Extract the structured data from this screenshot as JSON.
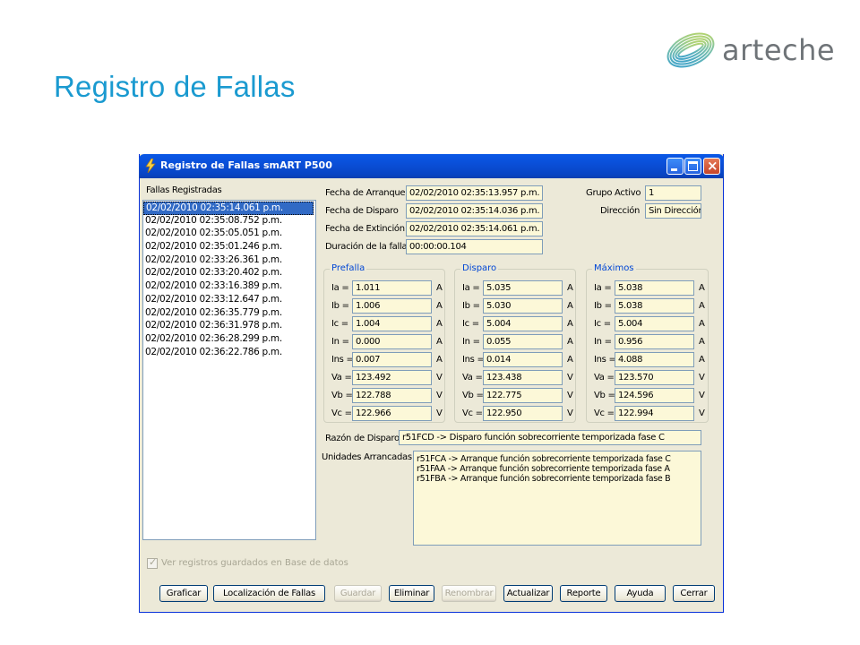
{
  "slide": {
    "title": "Registro de Fallas",
    "logo_text": "arteche"
  },
  "window": {
    "title": "Registro de Fallas smART P500",
    "fallas_label": "Fallas Registradas",
    "fallas": [
      "02/02/2010 02:35:14.061 p.m.",
      "02/02/2010 02:35:08.752 p.m.",
      "02/02/2010 02:35:05.051 p.m.",
      "02/02/2010 02:35:01.246 p.m.",
      "02/02/2010 02:33:26.361 p.m.",
      "02/02/2010 02:33:20.402 p.m.",
      "02/02/2010 02:33:16.389 p.m.",
      "02/02/2010 02:33:12.647 p.m.",
      "02/02/2010 02:36:35.779 p.m.",
      "02/02/2010 02:36:31.978 p.m.",
      "02/02/2010 02:36:28.299 p.m.",
      "02/02/2010 02:36:22.786 p.m."
    ],
    "info": {
      "arranque_label": "Fecha de Arranque",
      "arranque": "02/02/2010 02:35:13.957 p.m.",
      "disparo_label": "Fecha de Disparo",
      "disparo": "02/02/2010 02:35:14.036 p.m.",
      "extincion_label": "Fecha de Extinción",
      "extincion": "02/02/2010 02:35:14.061 p.m.",
      "duracion_label": "Duración de la falla",
      "duracion": "00:00:00.104",
      "grupo_label": "Grupo Activo",
      "grupo": "1",
      "direccion_label": "Dirección",
      "direccion": "Sin Dirección"
    },
    "groups": {
      "prefalla": {
        "title": "Prefalla",
        "rows": [
          {
            "label": "Ia =",
            "value": "1.011",
            "unit": "A"
          },
          {
            "label": "Ib =",
            "value": "1.006",
            "unit": "A"
          },
          {
            "label": "Ic =",
            "value": "1.004",
            "unit": "A"
          },
          {
            "label": "In =",
            "value": "0.000",
            "unit": "A"
          },
          {
            "label": "Ins =",
            "value": "0.007",
            "unit": "A"
          },
          {
            "label": "Va =",
            "value": "123.492",
            "unit": "V"
          },
          {
            "label": "Vb =",
            "value": "122.788",
            "unit": "V"
          },
          {
            "label": "Vc =",
            "value": "122.966",
            "unit": "V"
          }
        ]
      },
      "disparo": {
        "title": "Disparo",
        "rows": [
          {
            "label": "Ia =",
            "value": "5.035",
            "unit": "A"
          },
          {
            "label": "Ib =",
            "value": "5.030",
            "unit": "A"
          },
          {
            "label": "Ic =",
            "value": "5.004",
            "unit": "A"
          },
          {
            "label": "In =",
            "value": "0.055",
            "unit": "A"
          },
          {
            "label": "Ins =",
            "value": "0.014",
            "unit": "A"
          },
          {
            "label": "Va =",
            "value": "123.438",
            "unit": "V"
          },
          {
            "label": "Vb =",
            "value": "122.775",
            "unit": "V"
          },
          {
            "label": "Vc =",
            "value": "122.950",
            "unit": "V"
          }
        ]
      },
      "maximos": {
        "title": "Máximos",
        "rows": [
          {
            "label": "Ia =",
            "value": "5.038",
            "unit": "A"
          },
          {
            "label": "Ib =",
            "value": "5.038",
            "unit": "A"
          },
          {
            "label": "Ic =",
            "value": "5.004",
            "unit": "A"
          },
          {
            "label": "In =",
            "value": "0.956",
            "unit": "A"
          },
          {
            "label": "Ins =",
            "value": "4.088",
            "unit": "A"
          },
          {
            "label": "Va =",
            "value": "123.570",
            "unit": "V"
          },
          {
            "label": "Vb =",
            "value": "124.596",
            "unit": "V"
          },
          {
            "label": "Vc =",
            "value": "122.994",
            "unit": "V"
          }
        ]
      }
    },
    "razon_label": "Razón de Disparo",
    "razon": "r51FCD -> Disparo función sobrecorriente temporizada fase C",
    "unidades_label": "Unidades Arrancadas",
    "unidades": [
      "r51FCA -> Arranque función sobrecorriente temporizada fase C",
      "r51FAA -> Arranque función sobrecorriente temporizada fase A",
      "r51FBA -> Arranque función sobrecorriente temporizada fase B"
    ],
    "checkbox_label": "Ver registros guardados en Base de datos",
    "buttons": {
      "graficar": "Graficar",
      "localizacion": "Localización de Fallas",
      "guardar": "Guardar",
      "eliminar": "Eliminar",
      "renombrar": "Renombrar",
      "actualizar": "Actualizar",
      "reporte": "Reporte",
      "ayuda": "Ayuda",
      "cerrar": "Cerrar"
    }
  },
  "colors": {
    "title_blue": "#1a9ad0",
    "field_bg": "#fcf8d8",
    "titlebar": "#0a4fd8",
    "selection": "#316ac5"
  }
}
